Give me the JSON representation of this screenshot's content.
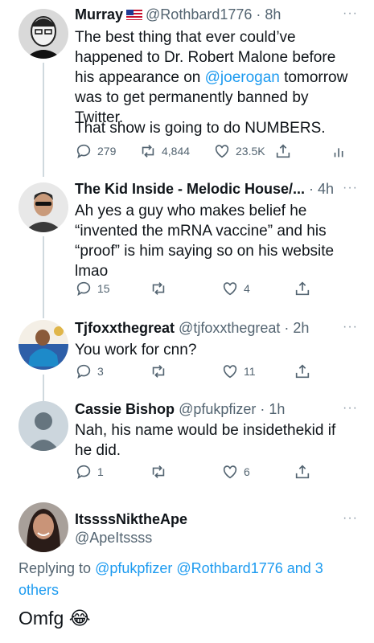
{
  "tweets": [
    {
      "name": "Murray",
      "handle": "@Rothbard1776",
      "time": "· 8h",
      "text_before": "The best thing that ever could’ve happened to Dr. Robert Malone before his appearance on ",
      "text_link": "@joerogan",
      "text_after": " tomorrow was to get permanently banned by Twitter.",
      "text_2": "That show is going to do NUMBERS.",
      "replies": "279",
      "retweets": "4,844",
      "likes": "23.5K"
    },
    {
      "name": "The Kid Inside - Melodic House/...",
      "time": "· 4h",
      "text": "Ah yes a guy who makes belief he “invented the mRNA vaccine” and his “proof” is him saying so on his website lmao",
      "replies": "15",
      "retweets": "",
      "likes": "4"
    },
    {
      "name": "Tjfoxxthegreat",
      "handle": "@tjfoxxthegreat",
      "time": "· 2h",
      "text": "You work for cnn?",
      "replies": "3",
      "retweets": "",
      "likes": "11"
    },
    {
      "name": "Cassie Bishop",
      "handle": "@pfukpfizer",
      "time": "· 1h",
      "text": "Nah, his name would be insidethekid if he did.",
      "replies": "1",
      "retweets": "",
      "likes": "6"
    }
  ],
  "main": {
    "name": "ItssssNiktheApe",
    "handle": "@ApeItssss",
    "replying_prefix": "Replying to ",
    "replying_users": "@pfukpfizer @Rothbard1776 and 3 others",
    "text": "Omfg",
    "emoji": "😂"
  },
  "more_label": "···",
  "colors": {
    "link": "#1d9bf0",
    "muted": "#536471",
    "line": "#cfd9de"
  },
  "icons": [
    "reply-icon",
    "retweet-icon",
    "like-icon",
    "share-icon",
    "analytics-icon",
    "us-flag-icon"
  ]
}
